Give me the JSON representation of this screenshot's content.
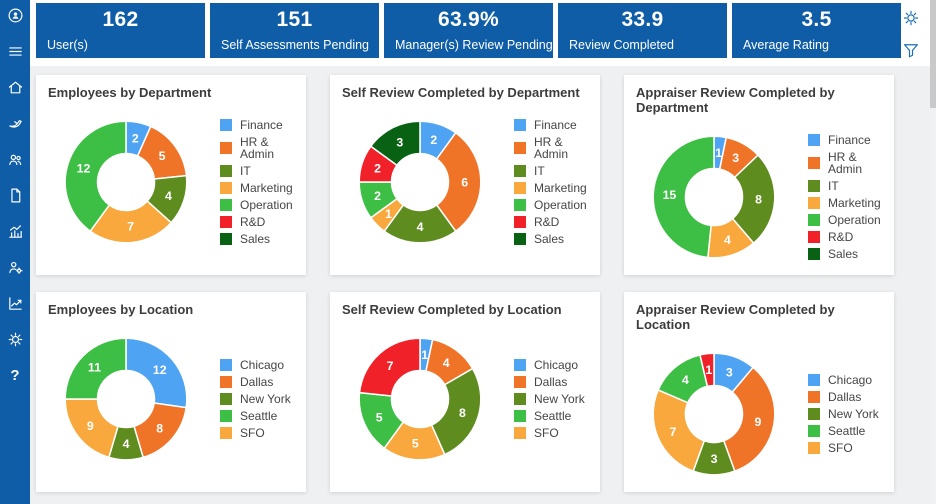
{
  "theme": {
    "sidebar_bg": "#0e5da6",
    "kpi_card_bg": "#0e5da6",
    "main_bg": "#eef0f2",
    "panel_bg": "#ffffff",
    "accent_icon_blue": "#1b6fb5"
  },
  "sidebar": {
    "icons": [
      "logo-avatar-icon",
      "menu-icon",
      "home-icon",
      "dove-icon",
      "team-icon",
      "document-icon",
      "bar-chart-icon",
      "user-settings-icon",
      "line-chart-icon",
      "settings-icon",
      "help-icon"
    ],
    "help_glyph": "?"
  },
  "header": {
    "kpis": [
      {
        "value": "162",
        "label": "User(s)"
      },
      {
        "value": "151",
        "label": "Self Assessments Pending"
      },
      {
        "value": "63.9%",
        "label": "Manager(s) Review Pending"
      },
      {
        "value": "33.9",
        "label": "Review Completed"
      },
      {
        "value": "3.5",
        "label": "Average Rating"
      }
    ],
    "actions": [
      "settings-icon",
      "filter-icon"
    ]
  },
  "chart_data": [
    {
      "type": "donut",
      "title": "Employees by Department",
      "legend": [
        {
          "label": "Finance",
          "color": "#4ea4f2"
        },
        {
          "label": "HR & Admin",
          "color": "#ef7428"
        },
        {
          "label": "IT",
          "color": "#5e8c1f"
        },
        {
          "label": "Marketing",
          "color": "#f8a83c"
        },
        {
          "label": "Operation",
          "color": "#3dbe44"
        },
        {
          "label": "R&D",
          "color": "#f02128"
        },
        {
          "label": "Sales",
          "color": "#096213"
        }
      ],
      "slices": [
        {
          "label": "Finance",
          "value": 2,
          "color": "#4ea4f2"
        },
        {
          "label": "HR & Admin",
          "value": 5,
          "color": "#ef7428"
        },
        {
          "label": "IT",
          "value": 4,
          "color": "#5e8c1f"
        },
        {
          "label": "Marketing",
          "value": 7,
          "color": "#f8a83c"
        },
        {
          "label": "Operation",
          "value": 12,
          "color": "#3dbe44"
        }
      ]
    },
    {
      "type": "donut",
      "title": "Self Review Completed by Department",
      "legend": [
        {
          "label": "Finance",
          "color": "#4ea4f2"
        },
        {
          "label": "HR & Admin",
          "color": "#ef7428"
        },
        {
          "label": "IT",
          "color": "#5e8c1f"
        },
        {
          "label": "Marketing",
          "color": "#f8a83c"
        },
        {
          "label": "Operation",
          "color": "#3dbe44"
        },
        {
          "label": "R&D",
          "color": "#f02128"
        },
        {
          "label": "Sales",
          "color": "#096213"
        }
      ],
      "slices": [
        {
          "label": "Finance",
          "value": 2,
          "color": "#4ea4f2"
        },
        {
          "label": "HR & Admin",
          "value": 6,
          "color": "#ef7428"
        },
        {
          "label": "IT",
          "value": 4,
          "color": "#5e8c1f"
        },
        {
          "label": "Marketing",
          "value": 1,
          "color": "#f8a83c"
        },
        {
          "label": "Operation",
          "value": 2,
          "color": "#3dbe44"
        },
        {
          "label": "R&D",
          "value": 2,
          "color": "#f02128"
        },
        {
          "label": "Sales",
          "value": 3,
          "color": "#096213"
        }
      ]
    },
    {
      "type": "donut",
      "title": "Appraiser Review Completed by Department",
      "legend": [
        {
          "label": "Finance",
          "color": "#4ea4f2"
        },
        {
          "label": "HR & Admin",
          "color": "#ef7428"
        },
        {
          "label": "IT",
          "color": "#5e8c1f"
        },
        {
          "label": "Marketing",
          "color": "#f8a83c"
        },
        {
          "label": "Operation",
          "color": "#3dbe44"
        },
        {
          "label": "R&D",
          "color": "#f02128"
        },
        {
          "label": "Sales",
          "color": "#096213"
        }
      ],
      "slices": [
        {
          "label": "Finance",
          "value": 1,
          "color": "#4ea4f2"
        },
        {
          "label": "HR & Admin",
          "value": 3,
          "color": "#ef7428"
        },
        {
          "label": "IT",
          "value": 8,
          "color": "#5e8c1f"
        },
        {
          "label": "Marketing",
          "value": 4,
          "color": "#f8a83c"
        },
        {
          "label": "Operation",
          "value": 15,
          "color": "#3dbe44"
        }
      ]
    },
    {
      "type": "donut",
      "title": "Employees by Location",
      "legend": [
        {
          "label": "Chicago",
          "color": "#4ea4f2"
        },
        {
          "label": "Dallas",
          "color": "#ef7428"
        },
        {
          "label": "New York",
          "color": "#5e8c1f"
        },
        {
          "label": "Seattle",
          "color": "#3dbe44"
        },
        {
          "label": "SFO",
          "color": "#f8a83c"
        }
      ],
      "slices": [
        {
          "label": "Chicago",
          "value": 12,
          "color": "#4ea4f2"
        },
        {
          "label": "Dallas",
          "value": 8,
          "color": "#ef7428"
        },
        {
          "label": "New York",
          "value": 4,
          "color": "#5e8c1f"
        },
        {
          "label": "SFO",
          "value": 9,
          "color": "#f8a83c"
        },
        {
          "label": "Seattle",
          "value": 11,
          "color": "#3dbe44"
        }
      ]
    },
    {
      "type": "donut",
      "title": "Self Review Completed by Location",
      "legend": [
        {
          "label": "Chicago",
          "color": "#4ea4f2"
        },
        {
          "label": "Dallas",
          "color": "#ef7428"
        },
        {
          "label": "New York",
          "color": "#5e8c1f"
        },
        {
          "label": "Seattle",
          "color": "#3dbe44"
        },
        {
          "label": "SFO",
          "color": "#f8a83c"
        }
      ],
      "slices": [
        {
          "label": "Chicago",
          "value": 1,
          "color": "#4ea4f2"
        },
        {
          "label": "Dallas",
          "value": 4,
          "color": "#ef7428"
        },
        {
          "label": "New York",
          "value": 8,
          "color": "#5e8c1f"
        },
        {
          "label": "SFO",
          "value": 5,
          "color": "#f8a83c"
        },
        {
          "label": "Seattle",
          "value": 5,
          "color": "#3dbe44"
        },
        {
          "label": "",
          "value": 7,
          "color": "#f02128"
        }
      ]
    },
    {
      "type": "donut",
      "title": "Appraiser Review Completed by Location",
      "legend": [
        {
          "label": "Chicago",
          "color": "#4ea4f2"
        },
        {
          "label": "Dallas",
          "color": "#ef7428"
        },
        {
          "label": "New York",
          "color": "#5e8c1f"
        },
        {
          "label": "Seattle",
          "color": "#3dbe44"
        },
        {
          "label": "SFO",
          "color": "#f8a83c"
        }
      ],
      "slices": [
        {
          "label": "Chicago",
          "value": 3,
          "color": "#4ea4f2"
        },
        {
          "label": "Dallas",
          "value": 9,
          "color": "#ef7428"
        },
        {
          "label": "New York",
          "value": 3,
          "color": "#5e8c1f"
        },
        {
          "label": "SFO",
          "value": 7,
          "color": "#f8a83c"
        },
        {
          "label": "Seattle",
          "value": 4,
          "color": "#3dbe44"
        },
        {
          "label": "",
          "value": 1,
          "color": "#f02128"
        }
      ]
    }
  ]
}
